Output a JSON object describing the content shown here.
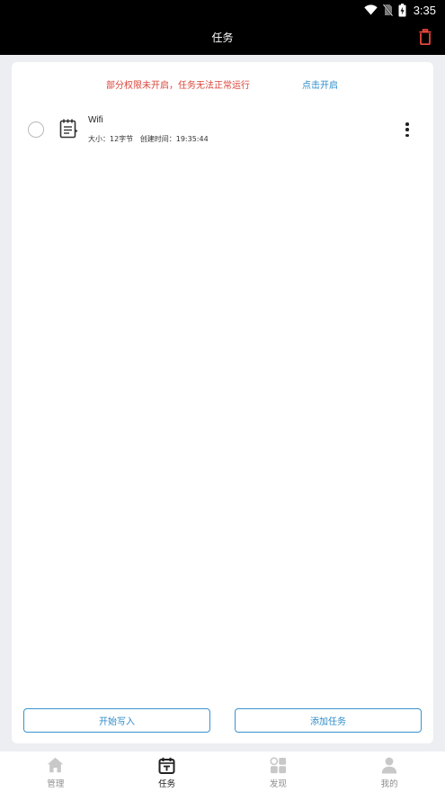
{
  "status_bar": {
    "time": "3:35"
  },
  "app_bar": {
    "title": "任务"
  },
  "warning": {
    "message": "部分权限未开启，任务无法正常运行",
    "action": "点击开启"
  },
  "tasks": [
    {
      "name": "Wifi",
      "size": "大小：12字节",
      "created": "创建时间：19:35:44"
    }
  ],
  "buttons": {
    "start_write": "开始写入",
    "add_task": "添加任务"
  },
  "bottom_nav": [
    {
      "label": "管理",
      "icon": "home-icon",
      "active": false
    },
    {
      "label": "任务",
      "icon": "task-icon",
      "active": true
    },
    {
      "label": "发现",
      "icon": "discover-icon",
      "active": false
    },
    {
      "label": "我的",
      "icon": "user-icon",
      "active": false
    }
  ],
  "colors": {
    "accent": "#2e8bc8",
    "warning": "#d9453a",
    "delete": "#e5453b",
    "inactive": "#c8c8c8"
  }
}
